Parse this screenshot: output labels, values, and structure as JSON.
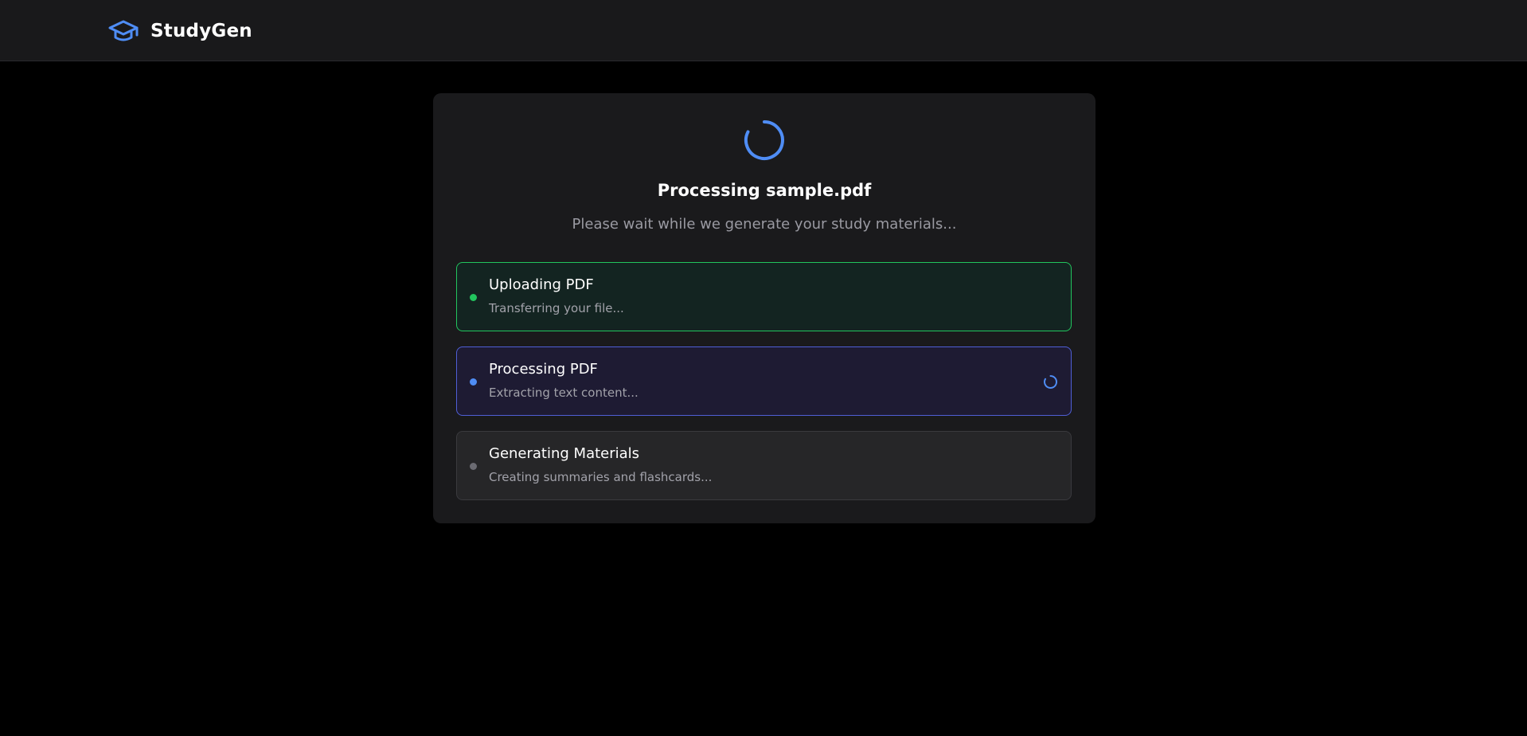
{
  "app": {
    "name": "StudyGen",
    "logo_icon": "graduation-cap-icon",
    "accent_color": "#4f8df5"
  },
  "processing": {
    "title": "Processing sample.pdf",
    "subtitle": "Please wait while we generate your study materials..."
  },
  "steps": [
    {
      "title": "Uploading PDF",
      "description": "Transferring your file...",
      "status": "done",
      "dot_color": "#22c55e"
    },
    {
      "title": "Processing PDF",
      "description": "Extracting text content...",
      "status": "active",
      "dot_color": "#4f8df5"
    },
    {
      "title": "Generating Materials",
      "description": "Creating summaries and flashcards...",
      "status": "pending",
      "dot_color": "#6b6b72"
    }
  ]
}
